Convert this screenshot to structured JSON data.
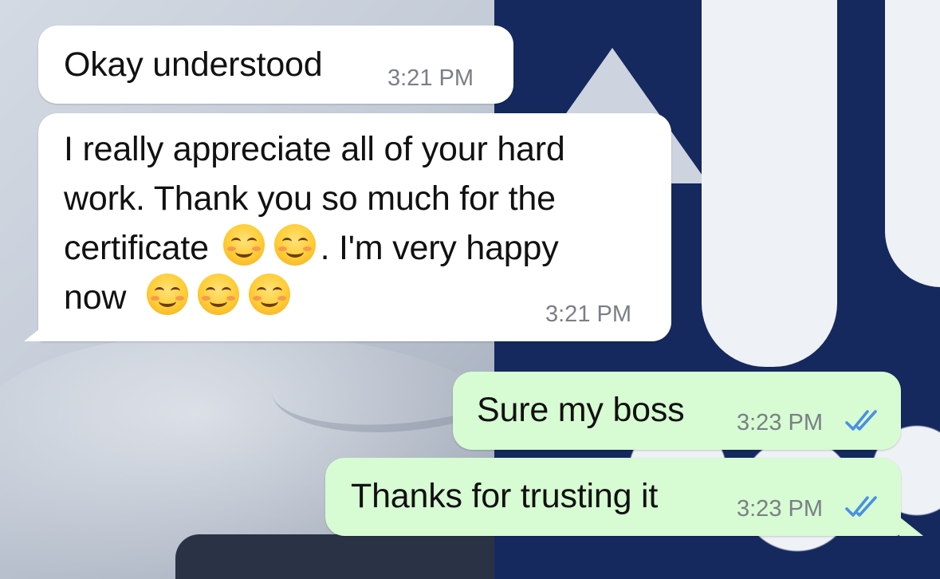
{
  "messages": [
    {
      "direction": "incoming",
      "text": "Okay understood",
      "time": "3:21 PM"
    },
    {
      "direction": "incoming",
      "text_parts": [
        "I really appreciate all of your hard",
        "work. Thank you so much for the",
        "certificate",
        ". I'm very happy",
        "now"
      ],
      "emojis_line3": [
        "smiling-face-with-smiling-eyes",
        "smiling-face-with-smiling-eyes"
      ],
      "emojis_line4": [
        "smiling-face-with-smiling-eyes",
        "smiling-face-with-smiling-eyes",
        "smiling-face"
      ],
      "time": "3:21 PM"
    },
    {
      "direction": "outgoing",
      "text": "Sure my boss",
      "time": "3:23 PM",
      "status": "read"
    },
    {
      "direction": "outgoing",
      "text": "Thanks for trusting it",
      "time": "3:23 PM",
      "status": "read"
    }
  ],
  "colors": {
    "incoming_bubble": "#ffffff",
    "outgoing_bubble": "#d7fbd2",
    "read_ticks": "#4a90e2",
    "timestamp": "#7a7f87"
  }
}
